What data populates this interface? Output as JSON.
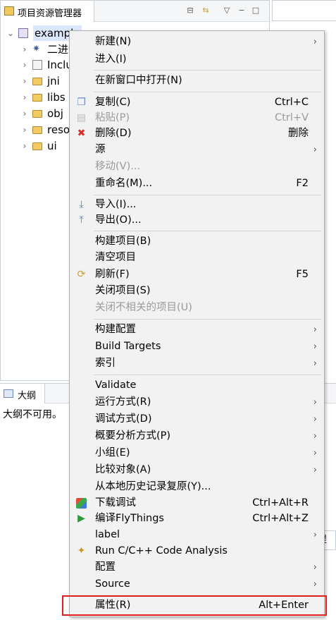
{
  "explorer": {
    "title": "项目资源管理器",
    "tree": [
      {
        "label": "example",
        "expanded": true,
        "icon": "c-project-icon"
      },
      {
        "label": "二进制",
        "icon": "binaries-icon"
      },
      {
        "label": "Includ",
        "icon": "includes-icon"
      },
      {
        "label": "jni",
        "icon": "folder-icon"
      },
      {
        "label": "libs",
        "icon": "folder-icon"
      },
      {
        "label": "obj",
        "icon": "folder-icon"
      },
      {
        "label": "resou",
        "icon": "folder-icon"
      },
      {
        "label": "ui",
        "icon": "folder-icon"
      }
    ]
  },
  "outline": {
    "title": "大纲",
    "message": "大纲不可用。"
  },
  "side_tab": {
    "label": "提显"
  },
  "menu": {
    "items": [
      {
        "label": "新建(N)",
        "submenu": true
      },
      {
        "label": "进入(I)"
      },
      {
        "label": "在新窗口中打开(N)"
      },
      {
        "label": "复制(C)",
        "shortcut": "Ctrl+C",
        "icon": "copy-icon"
      },
      {
        "label": "粘贴(P)",
        "shortcut": "Ctrl+V",
        "icon": "paste-icon",
        "disabled": true
      },
      {
        "label": "删除(D)",
        "shortcut": "删除",
        "icon": "delete-icon"
      },
      {
        "label": "源",
        "submenu": true
      },
      {
        "label": "移动(V)...",
        "disabled": true
      },
      {
        "label": "重命名(M)...",
        "shortcut": "F2"
      },
      {
        "label": "导入(I)...",
        "icon": "import-icon"
      },
      {
        "label": "导出(O)...",
        "icon": "export-icon"
      },
      {
        "label": "构建项目(B)"
      },
      {
        "label": "清空项目"
      },
      {
        "label": "刷新(F)",
        "shortcut": "F5",
        "icon": "refresh-icon"
      },
      {
        "label": "关闭项目(S)"
      },
      {
        "label": "关闭不相关的项目(U)",
        "disabled": true
      },
      {
        "label": "构建配置",
        "submenu": true
      },
      {
        "label": "Build Targets",
        "submenu": true
      },
      {
        "label": "索引",
        "submenu": true
      },
      {
        "label": "Validate"
      },
      {
        "label": "运行方式(R)",
        "submenu": true
      },
      {
        "label": "调试方式(D)",
        "submenu": true
      },
      {
        "label": "概要分析方式(P)",
        "submenu": true
      },
      {
        "label": "小组(E)",
        "submenu": true
      },
      {
        "label": "比较对象(A)",
        "submenu": true
      },
      {
        "label": "从本地历史记录复原(Y)..."
      },
      {
        "label": "下载调试",
        "shortcut": "Ctrl+Alt+R",
        "icon": "download-debug-icon"
      },
      {
        "label": "编译FlyThings",
        "shortcut": "Ctrl+Alt+Z",
        "icon": "play-icon"
      },
      {
        "label": "label",
        "submenu": true
      },
      {
        "label": "Run C/C++ Code Analysis",
        "icon": "code-analysis-icon"
      },
      {
        "label": "配置",
        "submenu": true
      },
      {
        "label": "Source",
        "submenu": true
      },
      {
        "label": "属性(R)",
        "shortcut": "Alt+Enter"
      }
    ]
  }
}
